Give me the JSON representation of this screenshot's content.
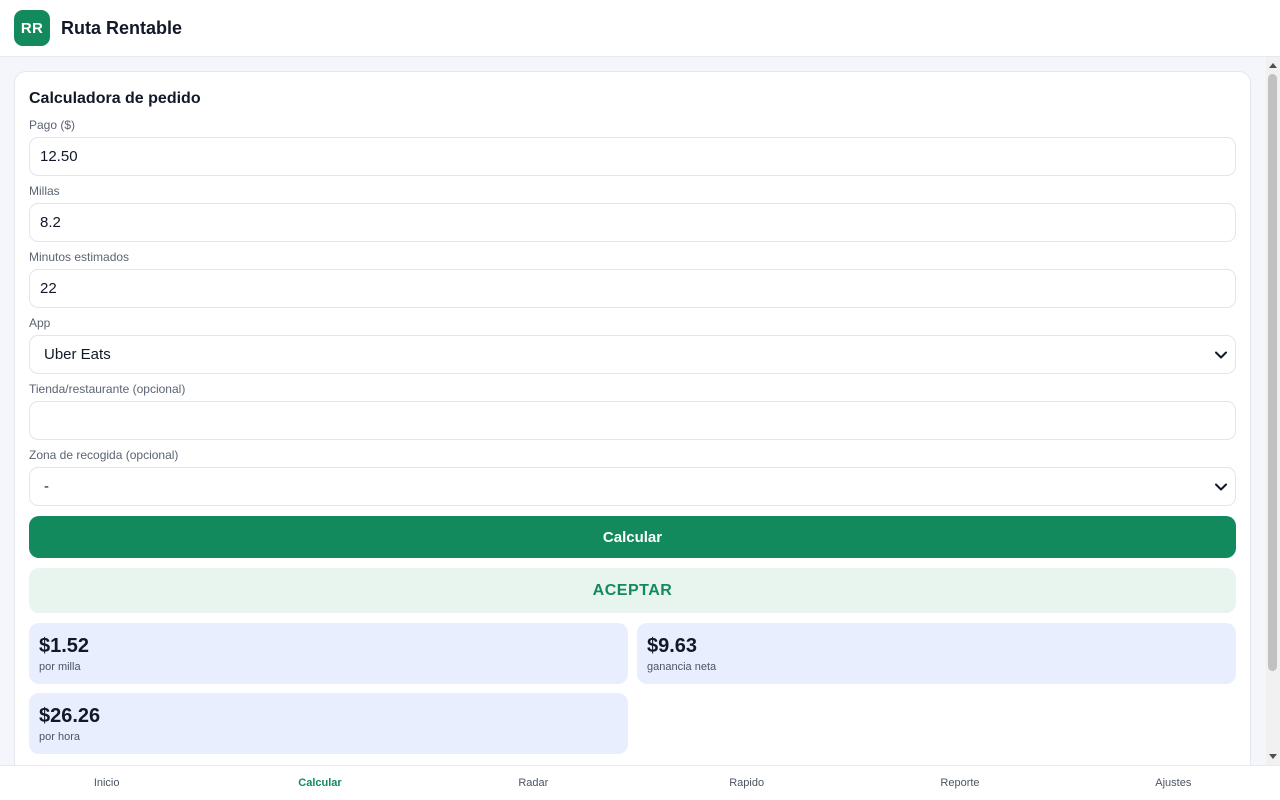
{
  "header": {
    "logo_text": "RR",
    "app_title": "Ruta Rentable"
  },
  "calculator": {
    "title": "Calculadora de pedido",
    "pago": {
      "label": "Pago ($)",
      "value": "12.50"
    },
    "millas": {
      "label": "Millas",
      "value": "8.2"
    },
    "minutos": {
      "label": "Minutos estimados",
      "value": "22"
    },
    "app": {
      "label": "App",
      "value": "Uber Eats"
    },
    "tienda": {
      "label": "Tienda/restaurante (opcional)",
      "value": ""
    },
    "zona": {
      "label": "Zona de recogida (opcional)",
      "value": "-"
    },
    "calculate_label": "Calcular",
    "verdict": "ACEPTAR",
    "results": {
      "per_mile": {
        "value": "$1.52",
        "label": "por milla"
      },
      "net": {
        "value": "$9.63",
        "label": "ganancia neta"
      },
      "per_hour": {
        "value": "$26.26",
        "label": "por hora"
      }
    }
  },
  "nav": {
    "items": [
      "Inicio",
      "Calcular",
      "Radar",
      "Rapido",
      "Reporte",
      "Ajustes"
    ],
    "active": "Calcular"
  },
  "colors": {
    "brand": "#138a5e",
    "verdict_bg": "#e7f5ee",
    "stat_bg": "#e8eefe"
  },
  "icons": {
    "select_arrow": "chevron-down-icon"
  }
}
